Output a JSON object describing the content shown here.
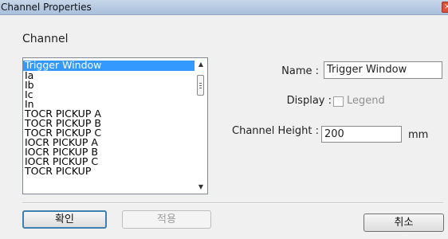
{
  "window": {
    "title": "Channel Properties"
  },
  "channel_group": {
    "label": "Channel"
  },
  "channel_list": {
    "items": [
      "Trigger Window",
      "Ia",
      "Ib",
      "Ic",
      "In",
      "TOCR PICKUP A",
      "TOCR PICKUP B",
      "TOCR PICKUP C",
      "IOCR PICKUP A",
      "IOCR PICKUP B",
      "IOCR PICKUP C",
      "TOCR PICKUP"
    ],
    "selected_index": 0,
    "scroll_up_glyph": "▲",
    "scroll_down_glyph": "▼"
  },
  "properties": {
    "name_label": "Name :",
    "name_value": "Trigger Window",
    "display_label": "Display :",
    "legend_label": "Legend",
    "legend_checked": false,
    "height_label": "Channel Height :",
    "height_value": "200",
    "height_unit": "mm"
  },
  "buttons": {
    "ok": "확인",
    "apply": "적용",
    "cancel": "취소"
  },
  "colors": {
    "selection": "#3399ff",
    "title_bar": "#b6c9e3",
    "disabled_text": "#9d9d9d"
  },
  "icons": {
    "close": "close-icon",
    "scroll_up": "scroll-up-icon",
    "scroll_down": "scroll-down-icon"
  }
}
